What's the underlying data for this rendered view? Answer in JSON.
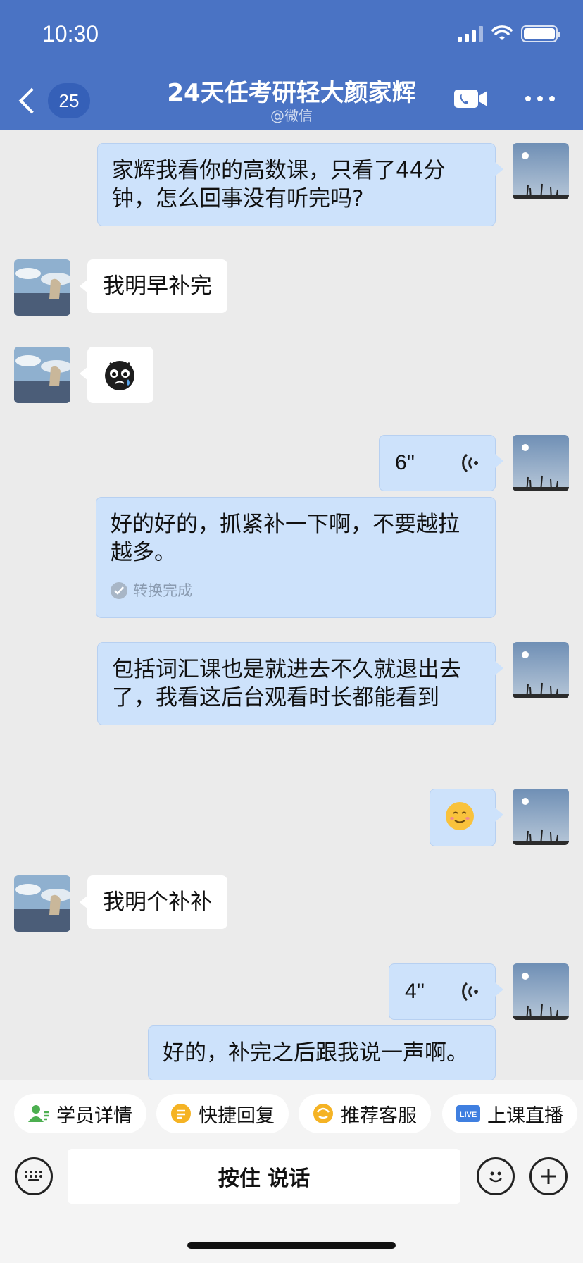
{
  "status_bar": {
    "time": "10:30"
  },
  "header": {
    "unread_count": "25",
    "title": "24天任考研轻大颜家辉",
    "subtitle": "@微信"
  },
  "messages": [
    {
      "side": "out",
      "type": "text",
      "text": "家辉我看你的高数课，只看了44分钟，怎么回事没有听完吗?"
    },
    {
      "side": "in",
      "type": "text",
      "text": "我明早补完"
    },
    {
      "side": "in",
      "type": "sticker",
      "icon": "crying-face-sticker-icon"
    },
    {
      "side": "out",
      "type": "voice",
      "duration": "6''"
    },
    {
      "side": "out",
      "type": "transcript",
      "text": "好的好的，抓紧补一下啊，不要越拉越多。",
      "status": "转换完成"
    },
    {
      "side": "out",
      "type": "text",
      "text": "包括词汇课也是就进去不久就退出去了，我看这后台观看时长都能看到"
    },
    {
      "side": "out",
      "type": "emoji",
      "icon": "smiling-face-emoji-icon"
    },
    {
      "side": "in",
      "type": "text",
      "text": "我明个补补"
    },
    {
      "side": "out",
      "type": "voice",
      "duration": "4''"
    },
    {
      "side": "out",
      "type": "transcript",
      "text": "好的，补完之后跟我说一声啊。"
    }
  ],
  "quick_actions": [
    {
      "label": "学员详情",
      "icon": "student-detail-icon",
      "color": "#4caf50"
    },
    {
      "label": "快捷回复",
      "icon": "quick-reply-icon",
      "color": "#f5b324"
    },
    {
      "label": "推荐客服",
      "icon": "recommend-service-icon",
      "color": "#f5b324"
    },
    {
      "label": "上课直播",
      "icon": "live-icon",
      "color": "#3f7fe0",
      "badge": "LIVE"
    }
  ],
  "input_bar": {
    "hold_to_talk": "按住 说话"
  },
  "colors": {
    "header": "#4a73c4",
    "outgoing_bubble": "#cde2fb",
    "incoming_bubble": "#ffffff"
  }
}
